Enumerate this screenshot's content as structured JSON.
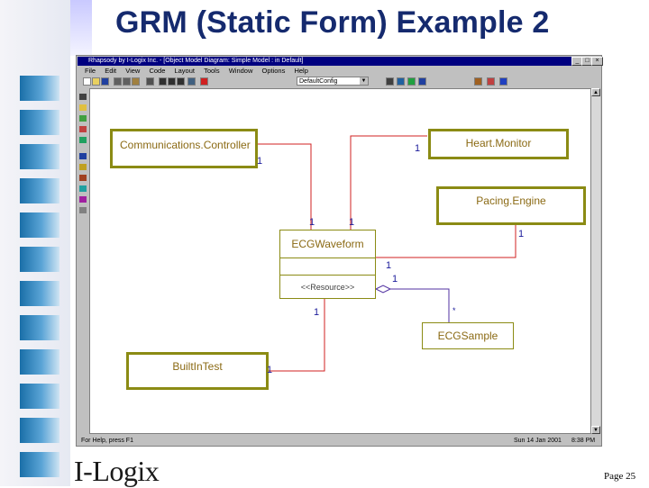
{
  "slide": {
    "title": "GRM (Static Form) Example 2",
    "logo_text": "I-Logix",
    "page_label": "Page 25"
  },
  "window": {
    "title": "Rhapsody by I-Logix Inc. - [Object Model Diagram: Simple Model : in Default]",
    "buttons": [
      "_",
      "□",
      "×"
    ]
  },
  "menu": [
    "File",
    "Edit",
    "View",
    "Code",
    "Layout",
    "Tools",
    "Window",
    "Options",
    "Help"
  ],
  "toolbar": {
    "config_value": "DefaultConfig",
    "icons": [
      "new-icon",
      "open-icon",
      "save-icon",
      "cut-icon",
      "copy-icon",
      "paste-icon",
      "print-icon",
      "zoom-in-icon",
      "zoom-out-icon",
      "search-icon",
      "grid-icon",
      "delete-icon",
      "undo-icon",
      "browser-icon",
      "generate-code-icon",
      "make-icon",
      "run-icon",
      "animation-icon",
      "help-icon"
    ]
  },
  "palette_icons": [
    "select-icon",
    "class-icon",
    "package-icon",
    "composite-icon",
    "association-icon",
    "directed-association-icon",
    "aggregation-icon",
    "composition-icon",
    "inheritance-icon",
    "dependency-icon",
    "note-icon"
  ],
  "diagram": {
    "classes": {
      "comm": "Communications.Controller",
      "heart": "Heart.Monitor",
      "pacing": "Pacing.Engine",
      "ecg": "ECGWaveform",
      "ecg_stereotype": "<<Resource>>",
      "sample": "ECGSample",
      "test": "BuiltInTest"
    },
    "multiplicities": {
      "comm_end": "1",
      "heart_end": "1",
      "ecg_from_comm": "1",
      "ecg_from_heart": "1",
      "pacing_end": "1",
      "ecg_to_pacing": "1",
      "ecg_agg": "1",
      "sample_end": "*",
      "ecg_to_test": "1",
      "test_end": "1"
    },
    "colors": {
      "association": "#d02020",
      "aggregation": "#5030a0",
      "class_border": "#8b8b14"
    }
  },
  "status": {
    "help_text": "For Help, press F1",
    "date": "Sun 14 Jan 2001",
    "time": "8:38 PM"
  }
}
